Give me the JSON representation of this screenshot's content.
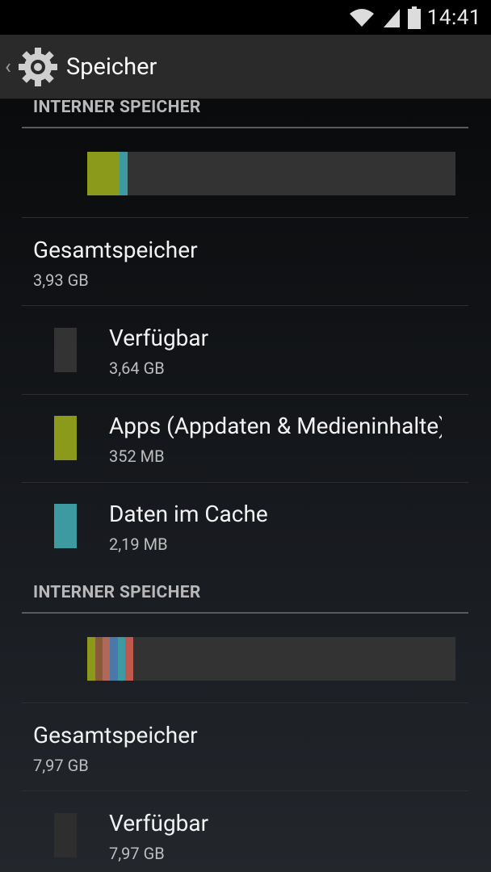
{
  "status_bar": {
    "time": "14:41",
    "icons": [
      "wifi-icon",
      "signal-icon",
      "battery-icon"
    ]
  },
  "action_bar": {
    "title": "Speicher",
    "icons": [
      "back-chevron-icon",
      "settings-gear-icon"
    ]
  },
  "sections": [
    {
      "header": "INTERNER SPEICHER",
      "bar_segments": [
        {
          "label": "Apps",
          "color": "#8c9a1c",
          "fraction": 0.087
        },
        {
          "label": "Cache",
          "color": "#3c9aa0",
          "fraction": 0.022
        }
      ],
      "total": {
        "label": "Gesamtspeicher",
        "value": "3,93 GB"
      },
      "items": [
        {
          "label": "Verfügbar",
          "value": "3,64 GB",
          "color": "#333333"
        },
        {
          "label": "Apps (Appdaten & Medieninhalte)",
          "value": "352 MB",
          "color": "#8c9a1c"
        },
        {
          "label": "Daten im Cache",
          "value": "2,19 MB",
          "color": "#3c9aa0"
        }
      ]
    },
    {
      "header": "INTERNER SPEICHER",
      "bar_segments": [
        {
          "color": "#8c9a1c",
          "fraction": 0.022
        },
        {
          "color": "#8a5a3a",
          "fraction": 0.02
        },
        {
          "color": "#b0685a",
          "fraction": 0.02
        },
        {
          "color": "#4a78a8",
          "fraction": 0.022
        },
        {
          "color": "#3c9aa0",
          "fraction": 0.02
        },
        {
          "color": "#c0584e",
          "fraction": 0.02
        }
      ],
      "total": {
        "label": "Gesamtspeicher",
        "value": "7,97 GB"
      },
      "items": [
        {
          "label": "Verfügbar",
          "value": "7,97 GB",
          "color": "#2e2e2e"
        }
      ]
    }
  ]
}
